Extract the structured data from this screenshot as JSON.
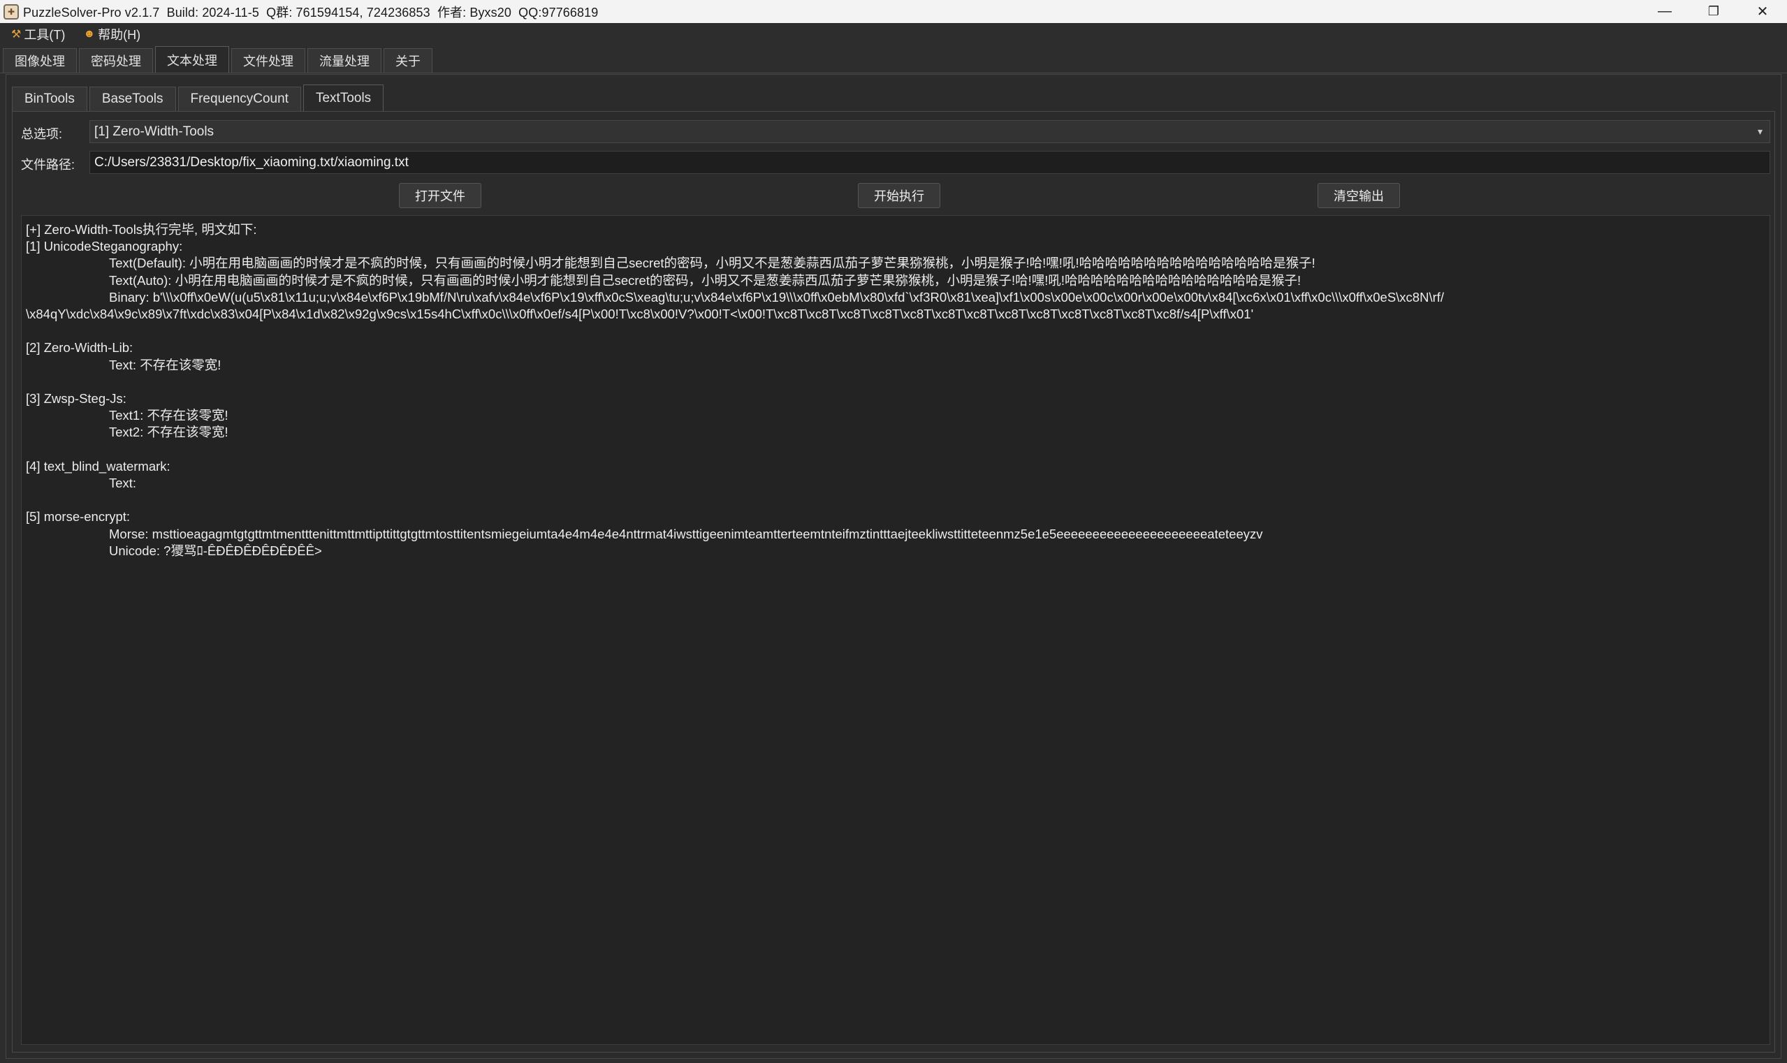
{
  "window": {
    "title": "PuzzleSolver-Pro v2.1.7  Build: 2024-11-5  Q群: 761594154, 724236853  作者: Byxs20  QQ:97766819",
    "icon": "puzzle-app-icon",
    "controls": {
      "minimize": "—",
      "maximize": "❐",
      "close": "✕"
    }
  },
  "menubar": {
    "items": [
      {
        "label": "工具(T)",
        "icon": "tools-icon"
      },
      {
        "label": "帮助(H)",
        "icon": "help-icon"
      }
    ]
  },
  "main_tabs": [
    "图像处理",
    "密码处理",
    "文本处理",
    "文件处理",
    "流量处理",
    "关于"
  ],
  "main_tabs_active": "文本处理",
  "sub_tabs": [
    "BinTools",
    "BaseTools",
    "FrequencyCount",
    "TextTools"
  ],
  "sub_tabs_active": "TextTools",
  "form": {
    "option_label": "总选项:",
    "option_value": "[1] Zero-Width-Tools",
    "path_label": "文件路径:",
    "path_value": "C:/Users/23831/Desktop/fix_xiaoming.txt/xiaoming.txt"
  },
  "buttons": {
    "open": "打开文件",
    "run": "开始执行",
    "clear": "清空输出"
  },
  "output": {
    "lines": [
      {
        "indent": false,
        "text": "[+] Zero-Width-Tools执行完毕, 明文如下:"
      },
      {
        "indent": false,
        "text": "[1] UnicodeSteganography:"
      },
      {
        "indent": true,
        "text": "Text(Default): 小明在用电脑画画的时候才是不疯的时候，只有画画的时候小明才能想到自己secret的密码，小明又不是葱姜蒜西瓜茄子萝芒果猕猴桃，小明是猴子!哈!嘿!吼!哈哈哈哈哈哈哈哈哈哈哈哈哈哈哈是猴子!"
      },
      {
        "indent": true,
        "text": "Text(Auto): 小明在用电脑画画的时候才是不疯的时候，只有画画的时候小明才能想到自己secret的密码，小明又不是葱姜蒜西瓜茄子萝芒果猕猴桃，小明是猴子!哈!嘿!吼!哈哈哈哈哈哈哈哈哈哈哈哈哈哈哈是猴子!"
      },
      {
        "indent": true,
        "text": "Binary: b'\\\\\\x0ff\\x0eW(u(u5\\x81\\x11u;u;v\\x84e\\xf6P\\x19bMf/N\\ru\\xafv\\x84e\\xf6P\\x19\\xff\\x0cS\\xeag\\tu;u;v\\x84e\\xf6P\\x19\\\\\\x0ff\\x0ebM\\x80\\xfd`\\xf3R0\\x81\\xea]\\xf1\\x00s\\x00e\\x00c\\x00r\\x00e\\x00tv\\x84[\\xc6x\\x01\\xff\\x0c\\\\\\x0ff\\x0eS\\xc8N\\rf/"
      },
      {
        "indent": false,
        "text": "\\x84qY\\xdc\\x84\\x9c\\x89\\x7ft\\xdc\\x83\\x04[P\\x84\\x1d\\x82\\x92g\\x9cs\\x15s4hC\\xff\\x0c\\\\\\x0ff\\x0ef/s4[P\\x00!T\\xc8\\x00!V?\\x00!T<\\x00!T\\xc8T\\xc8T\\xc8T\\xc8T\\xc8T\\xc8T\\xc8T\\xc8T\\xc8T\\xc8T\\xc8T\\xc8T\\xc8f/s4[P\\xff\\x01'"
      },
      {
        "blank": true
      },
      {
        "indent": false,
        "text": "[2] Zero-Width-Lib:"
      },
      {
        "indent": true,
        "text": "Text: 不存在该零宽!"
      },
      {
        "blank": true
      },
      {
        "indent": false,
        "text": "[3] Zwsp-Steg-Js:"
      },
      {
        "indent": true,
        "text": "Text1: 不存在该零宽!"
      },
      {
        "indent": true,
        "text": "Text2: 不存在该零宽!"
      },
      {
        "blank": true
      },
      {
        "indent": false,
        "text": "[4] text_blind_watermark:"
      },
      {
        "indent": true,
        "text": "Text:"
      },
      {
        "blank": true
      },
      {
        "indent": false,
        "text": "[5] morse-encrypt:"
      },
      {
        "indent": true,
        "text": "Morse: msttioeagagmtgtgttmtmentttenittmttmttipttittgtgttmtosttitentsmiegeiumta4e4m4e4e4nttrmat4iwsttigeenimteamtterteemtnteifmztintttaejteekliwsttitteteenmz5e1e5eeeeeeeeeeeeeeeeeeeeeateteeyzv"
      },
      {
        "indent": true,
        "text": "Unicode: ?獿骂ﾛ-ÊĐÊĐÊĐÊĐÊĐÊÊ>"
      }
    ]
  }
}
